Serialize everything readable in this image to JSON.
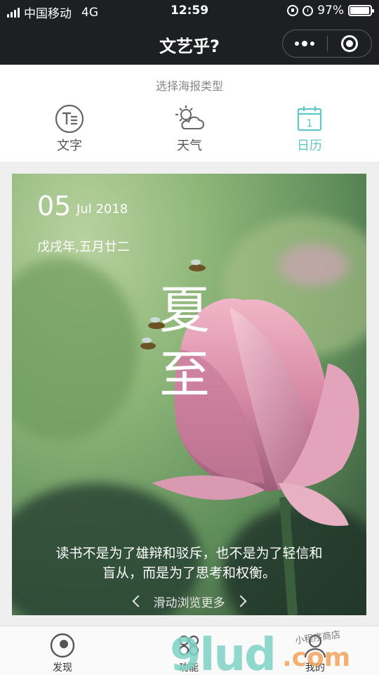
{
  "status_bar": {
    "carrier": "中国移动",
    "network": "4G",
    "time": "12:59",
    "battery": "97%",
    "battery_level": 0.97
  },
  "nav": {
    "title": "文艺乎?"
  },
  "selector": {
    "prompt": "选择海报类型",
    "types": [
      {
        "label": "文字",
        "icon": "text-icon"
      },
      {
        "label": "天气",
        "icon": "weather-icon"
      },
      {
        "label": "日历",
        "icon": "calendar-icon",
        "active": true
      }
    ],
    "calendar_icon_number": "1",
    "active_color": "#5fc8c6"
  },
  "poster": {
    "day": "05",
    "month_year": "Jul 2018",
    "lunar": "戊戌年,五月廿二",
    "term_line1": "夏",
    "term_line2": "至",
    "quote_line1": "读书不是为了雄辩和驳斥，也不是为了轻信和",
    "quote_line2": "盲从，而是为了思考和权衡。",
    "browse": "滑动浏览更多"
  },
  "tabbar": {
    "tabs": [
      {
        "label": "发现",
        "icon": "discover-icon"
      },
      {
        "label": "功能",
        "icon": "function-icon"
      },
      {
        "label": "我的",
        "icon": "user-icon"
      }
    ]
  },
  "watermark": {
    "text": "9lud",
    "suffix": ".com",
    "handwriting": "小程序商店"
  }
}
